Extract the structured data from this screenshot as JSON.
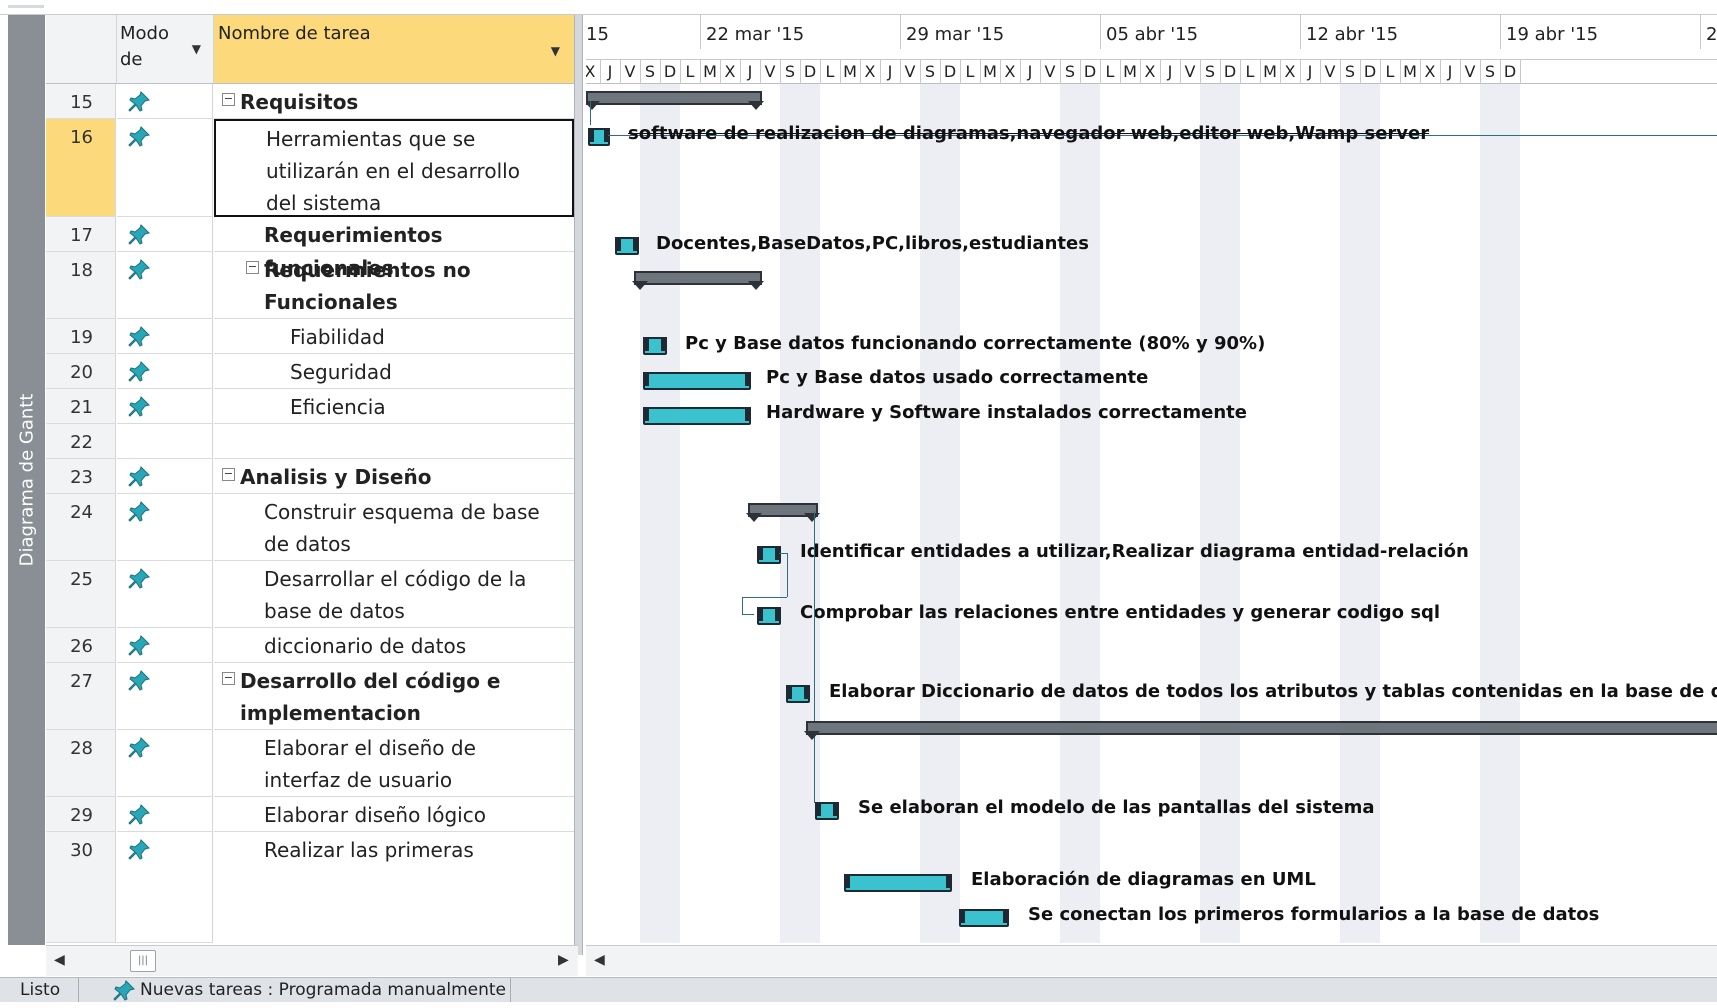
{
  "sidebar": {
    "label": "Diagrama de Gantt"
  },
  "table": {
    "headers": {
      "mode": "Modo de",
      "name": "Nombre de tarea"
    },
    "rows": [
      {
        "id": "15",
        "name": "Requisitos",
        "bold": true,
        "summary": true,
        "level": 0,
        "lines": 1
      },
      {
        "id": "16",
        "name": "Herramientas que se utilizarán en el desarrollo del sistema",
        "line1": "Herramientas que se",
        "line2": "utilizarán en el desarrollo",
        "line3": "del sistema",
        "bold": false,
        "level": 1,
        "lines": 3,
        "selected": true
      },
      {
        "id": "17",
        "name": "Requerimientos funcionales",
        "bold": true,
        "level": 1,
        "lines": 1
      },
      {
        "id": "18",
        "name": "Requermientos no Funcionales",
        "line1": "Requermientos no",
        "line2": "Funcionales",
        "bold": true,
        "summary": true,
        "level": 1,
        "lines": 2
      },
      {
        "id": "19",
        "name": "Fiabilidad",
        "level": 2,
        "lines": 1
      },
      {
        "id": "20",
        "name": "Seguridad",
        "level": 2,
        "lines": 1
      },
      {
        "id": "21",
        "name": "Eficiencia",
        "level": 2,
        "lines": 1
      },
      {
        "id": "22",
        "name": "",
        "level": 0,
        "lines": 1,
        "empty": true
      },
      {
        "id": "23",
        "name": "Analisis y Diseño",
        "bold": true,
        "summary": true,
        "level": 0,
        "lines": 1
      },
      {
        "id": "24",
        "name": "Construir esquema de base de datos",
        "line1": "Construir esquema de base",
        "line2": "de datos",
        "level": 1,
        "lines": 2
      },
      {
        "id": "25",
        "name": "Desarrollar el código de la base de datos",
        "line1": "Desarrollar el código de la",
        "line2": "base de datos",
        "level": 1,
        "lines": 2
      },
      {
        "id": "26",
        "name": "diccionario de datos",
        "level": 1,
        "lines": 1
      },
      {
        "id": "27",
        "name": "Desarrollo del código e implementacion",
        "line1": "Desarrollo del código e",
        "line2": "implementacion",
        "bold": true,
        "summary": true,
        "level": 0,
        "lines": 2
      },
      {
        "id": "28",
        "name": "Elaborar el diseño de interfaz de usuario",
        "line1": "Elaborar el diseño de",
        "line2": "interfaz de usuario",
        "level": 1,
        "lines": 2
      },
      {
        "id": "29",
        "name": "Elaborar diseño lógico",
        "level": 1,
        "lines": 1
      },
      {
        "id": "30",
        "name": "Realizar las primeras",
        "level": 1,
        "lines": 1
      }
    ]
  },
  "gantt": {
    "first_week_fragment": "15",
    "weeks": [
      "22 mar '15",
      "29 mar '15",
      "05 abr '15",
      "12 abr '15",
      "19 abr '15",
      "2"
    ],
    "day_letters": [
      "X",
      "J",
      "V",
      "S",
      "D",
      "L",
      "M",
      "X",
      "J",
      "V",
      "S",
      "D",
      "L",
      "M",
      "X",
      "J",
      "V",
      "S",
      "D",
      "L",
      "M",
      "X",
      "J",
      "V",
      "S",
      "D",
      "L",
      "M",
      "X",
      "J",
      "V",
      "S",
      "D",
      "L",
      "M",
      "X",
      "J",
      "V",
      "S",
      "D",
      "L",
      "M",
      "X",
      "J",
      "V",
      "S",
      "D"
    ],
    "bar_labels": {
      "r16": "software de realizacion de diagramas,navegador web,editor web,Wamp server",
      "r17": "Docentes,BaseDatos,PC,libros,estudiantes",
      "r19": "Pc y Base datos funcionando correctamente (80% y 90%)",
      "r20": "Pc y Base datos usado correctamente",
      "r21": "Hardware y Software instalados correctamente",
      "r24": "Identificar entidades a utilizar,Realizar diagrama entidad-relación",
      "r25": "Comprobar las relaciones entre entidades y generar codigo sql",
      "r26": "Elaborar Diccionario de datos de todos los atributos y tablas contenidas en la base de datos",
      "r28": "Se elaboran el modelo de las pantallas del sistema",
      "r29": "Elaboración de diagramas en UML",
      "r30": "Se conectan los primeros formularios a la base de datos"
    }
  },
  "status_bar": {
    "ready": "Listo",
    "new_tasks": "Nuevas tareas : Programada manualmente"
  },
  "colors": {
    "selected_header": "#fcd97a",
    "task_bar": "#3bc2cf",
    "summary_bar": "#6f757c"
  }
}
